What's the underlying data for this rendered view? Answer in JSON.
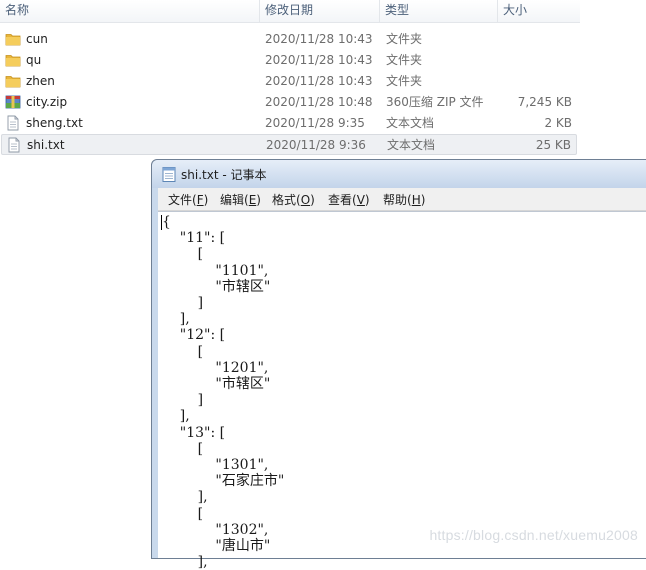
{
  "columns": {
    "name": "名称",
    "date": "修改日期",
    "type": "类型",
    "size": "大小"
  },
  "files": [
    {
      "name": "cun",
      "date": "2020/11/28 10:43",
      "type": "文件夹",
      "size": "",
      "icon": "folder-icon"
    },
    {
      "name": "qu",
      "date": "2020/11/28 10:43",
      "type": "文件夹",
      "size": "",
      "icon": "folder-icon"
    },
    {
      "name": "zhen",
      "date": "2020/11/28 10:43",
      "type": "文件夹",
      "size": "",
      "icon": "folder-icon"
    },
    {
      "name": "city.zip",
      "date": "2020/11/28 10:48",
      "type": "360压缩 ZIP 文件",
      "size": "7,245 KB",
      "icon": "zip-archive-icon"
    },
    {
      "name": "sheng.txt",
      "date": "2020/11/28 9:35",
      "type": "文本文档",
      "size": "2 KB",
      "icon": "text-file-icon"
    },
    {
      "name": "shi.txt",
      "date": "2020/11/28 9:36",
      "type": "文本文档",
      "size": "25 KB",
      "icon": "text-file-icon",
      "selected": true
    }
  ],
  "notepad": {
    "title": "shi.txt - 记事本",
    "menu": [
      {
        "label": "文件",
        "key": "F"
      },
      {
        "label": "编辑",
        "key": "E"
      },
      {
        "label": "格式",
        "key": "O"
      },
      {
        "label": "查看",
        "key": "V"
      },
      {
        "label": "帮助",
        "key": "H"
      }
    ],
    "content": "{\n    \"11\": [\n        [\n            \"1101\",\n            \"市辖区\"\n        ]\n    ],\n    \"12\": [\n        [\n            \"1201\",\n            \"市辖区\"\n        ]\n    ],\n    \"13\": [\n        [\n            \"1301\",\n            \"石家庄市\"\n        ],\n        [\n            \"1302\",\n            \"唐山市\"\n        ],"
  },
  "watermark": "https://blog.csdn.net/xuemu2008",
  "colors": {
    "folder": "#e8b53a",
    "selection": "#eef0f3",
    "titlebar": "#c3d4ea"
  }
}
